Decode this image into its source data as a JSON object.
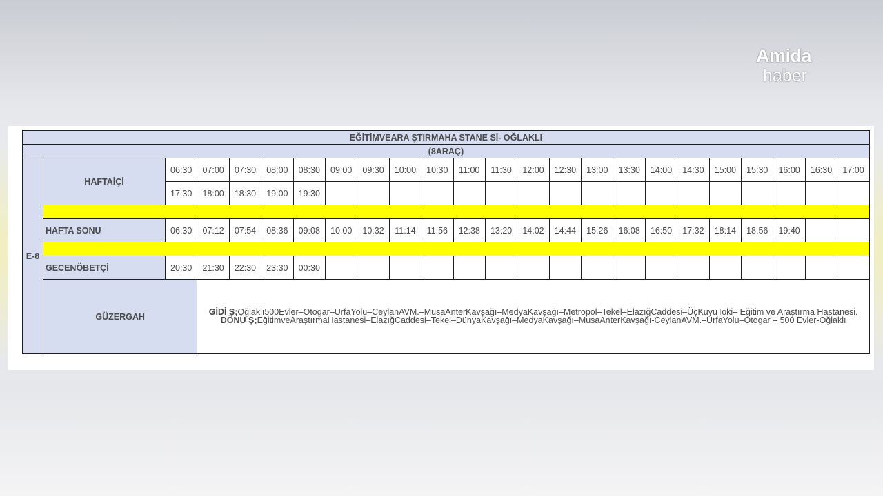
{
  "logo": {
    "top": "Amida",
    "bottom": "haber"
  },
  "schedule": {
    "title": "EĞİTİMVEARA ŞTIRMAHA STANE Sİ- OĞLAKLI",
    "vehicles": "(8ARAÇ)",
    "line_code": "E-8",
    "weekday_label": "HAFTAİÇİ",
    "weekday_row1": [
      "06:30",
      "07:00",
      "07:30",
      "08:00",
      "08:30",
      "09:00",
      "09:30",
      "10:00",
      "10:30",
      "11:00",
      "11:30",
      "12:00",
      "12:30",
      "13:00",
      "13:30",
      "14:00",
      "14:30",
      "15:00",
      "15:30",
      "16:00",
      "16:30",
      "17:00"
    ],
    "weekday_row2": [
      "17:30",
      "18:00",
      "18:30",
      "19:00",
      "19:30",
      "",
      "",
      "",
      "",
      "",
      "",
      "",
      "",
      "",
      "",
      "",
      "",
      "",
      "",
      "",
      "",
      ""
    ],
    "weekend_label": "HAFTA SONU",
    "weekend_row": [
      "06:30",
      "07:12",
      "07:54",
      "08:36",
      "09:08",
      "10:00",
      "10:32",
      "11:14",
      "11:56",
      "12:38",
      "13:20",
      "14:02",
      "14:44",
      "15:26",
      "16:08",
      "16:50",
      "17:32",
      "18:14",
      "18:56",
      "19:40",
      "",
      ""
    ],
    "night_label": "GECENÖBETÇİ",
    "night_row": [
      "20:30",
      "21:30",
      "22:30",
      "23:30",
      "00:30",
      "",
      "",
      "",
      "",
      "",
      "",
      "",
      "",
      "",
      "",
      "",
      "",
      "",
      "",
      "",
      "",
      ""
    ],
    "route_label": "GÜZERGAH",
    "route_go_label": "GİDİ Ş;",
    "route_go": "Oğlaklı500Evler–Otogar–UrfaYolu–CeylanAVM.–MusaAnterKavşağı–MedyaKavşağı–Metropol–Tekel–ElazığCaddesi–ÜçKuyuToki– Eğitim ve Araştırma Hastanesi.",
    "route_back_label": "DÖNÜ Ş;",
    "route_back": "EğitimveAraştırmaHastanesi–ElazığCaddesi–Tekel–DünyaKavşağı–MedyaKavşağı–MusaAnterKavşağı-CeylanAVM.–UrfaYolu–Otogar – 500 Evler-Oğlaklı"
  }
}
